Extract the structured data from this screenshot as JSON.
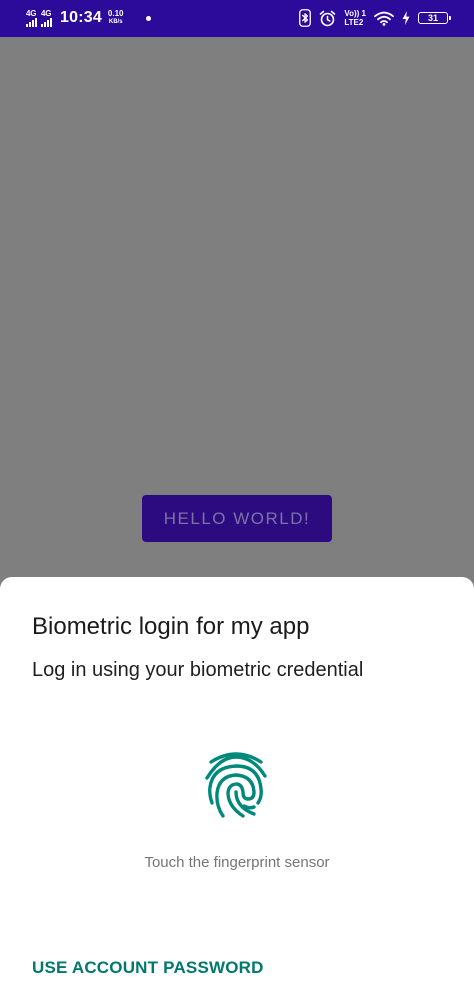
{
  "status_bar": {
    "sim1_network": "4G",
    "sim2_network": "4G",
    "time": "10:34",
    "data_speed": "0.10",
    "data_speed_unit": "KB/s",
    "volte_label": "Vo)) 1",
    "lte_label": "LTE2",
    "battery_level": "31",
    "icons": [
      "signal-icon",
      "signal-icon",
      "notification-dot-icon",
      "bluetooth-icon",
      "alarm-icon",
      "wifi-icon",
      "charging-icon",
      "battery-icon"
    ]
  },
  "app": {
    "button_label": "HELLO WORLD!"
  },
  "biometric_prompt": {
    "title": "Biometric login for my app",
    "subtitle": "Log in using your biometric credential",
    "icon": "fingerprint-icon",
    "hint": "Touch the fingerprint sensor",
    "negative_button_label": "USE ACCOUNT PASSWORD"
  },
  "colors": {
    "status_bar": "#2c0a9a",
    "scrim": "#7f7f7f",
    "primary_button": "#2c0a80",
    "accent": "#00786d",
    "fingerprint": "#00897b"
  }
}
